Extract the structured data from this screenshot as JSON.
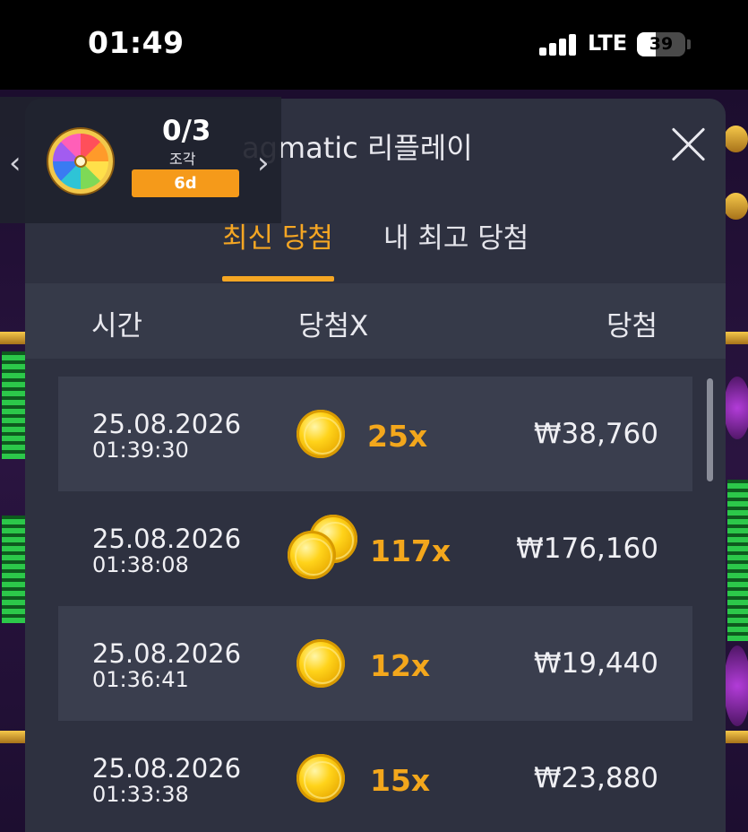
{
  "status_bar": {
    "time": "01:49",
    "network": "LTE",
    "battery": "39",
    "battery_level": 0.39
  },
  "reward_widget": {
    "count": "0/3",
    "label": "조각",
    "badge": "6d",
    "prev_icon": "chevron-left-icon",
    "next_icon": "chevron-right-icon"
  },
  "panel": {
    "title": "agmatic 리플레이",
    "close_icon": "close-icon",
    "tabs": [
      {
        "label": "최신 당첨",
        "active": true
      },
      {
        "label": "내 최고 당첨",
        "active": false
      }
    ],
    "columns": {
      "time": "시간",
      "multiplier": "당첨X",
      "win": "당첨"
    },
    "rows": [
      {
        "date": "25.08.2026",
        "time": "01:39:30",
        "multiplier": "25x",
        "win": "₩38,760",
        "coins": 1
      },
      {
        "date": "25.08.2026",
        "time": "01:38:08",
        "multiplier": "117x",
        "win": "₩176,160",
        "coins": 2
      },
      {
        "date": "25.08.2026",
        "time": "01:36:41",
        "multiplier": "12x",
        "win": "₩19,440",
        "coins": 1
      },
      {
        "date": "25.08.2026",
        "time": "01:33:38",
        "multiplier": "15x",
        "win": "₩23,880",
        "coins": 1
      }
    ]
  },
  "colors": {
    "accent": "#f5a623",
    "panel_bg": "#2e3140",
    "row_shaded": "#3a3e4e"
  }
}
